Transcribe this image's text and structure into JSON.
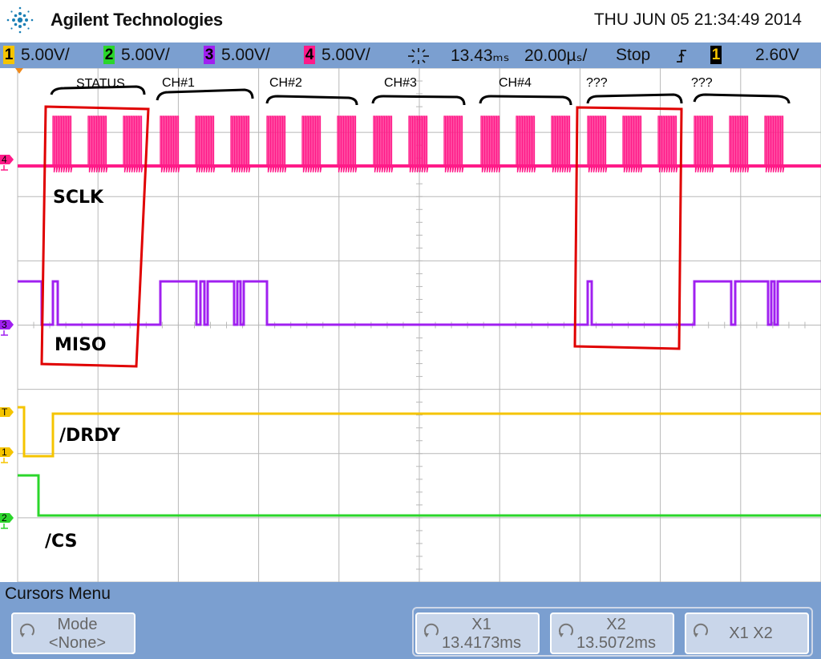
{
  "header": {
    "brand": "Agilent Technologies",
    "datetime": "THU JUN 05 21:34:49 2014"
  },
  "statusbar": {
    "ch1": {
      "num": "1",
      "scale": "5.00V/"
    },
    "ch2": {
      "num": "2",
      "scale": "5.00V/"
    },
    "ch3": {
      "num": "3",
      "scale": "5.00V/"
    },
    "ch4": {
      "num": "4",
      "scale": "5.00V/"
    },
    "delay": "13.43ₘₛ",
    "timebase": "20.00µₛ/",
    "run_state": "Stop",
    "trigger_source": "1",
    "trigger_level": "2.60V"
  },
  "annotations": {
    "groups": [
      "STATUS",
      "CH#1",
      "CH#2",
      "CH#3",
      "CH#4",
      "???",
      "???"
    ],
    "signals": [
      "SCLK",
      "MISO",
      "/DRDY",
      "/CS"
    ]
  },
  "markers": {
    "ch4": "4",
    "ch3": "3",
    "trigger": "T",
    "ch1": "1",
    "ch2": "2"
  },
  "menu": {
    "title": "Cursors Menu",
    "mode_label": "Mode",
    "mode_value": "<None>",
    "x1_label": "X1",
    "x1_value": "13.4173ms",
    "x2_label": "X2",
    "x2_value": "13.5072ms",
    "x1x2_label": "X1 X2"
  },
  "colors": {
    "ch1": "#f5c400",
    "ch2": "#2bd62b",
    "ch3": "#a020f0",
    "ch4": "#ff1a88",
    "highlight": "#e00000",
    "grid": "#b8b8b8",
    "bar": "#7b9fd0"
  }
}
